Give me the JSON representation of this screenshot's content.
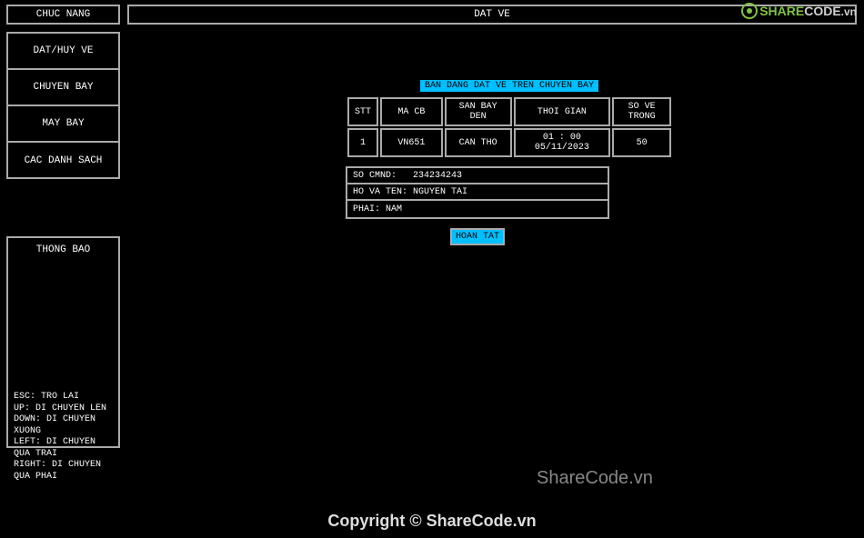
{
  "header": {
    "left": "CHUC NANG",
    "right": "DAT VE"
  },
  "menu": {
    "items": [
      "DAT/HUY VE",
      "CHUYEN BAY",
      "MAY BAY",
      "CAC DANH SACH"
    ]
  },
  "thong_bao": {
    "title": "THONG BAO",
    "help": {
      "esc": "ESC: TRO LAI",
      "up": "UP: DI CHUYEN LEN",
      "down": "DOWN: DI CHUYEN XUONG",
      "left": "LEFT: DI CHUYEN QUA TRAI",
      "right": "RIGHT: DI CHUYEN QUA PHAI"
    }
  },
  "content": {
    "title": "BAN DANG DAT VE TREN CHUYEN BAY",
    "table": {
      "headers": {
        "stt": "STT",
        "macb": "MA CB",
        "sanbay": "SAN BAY DEN",
        "thoigian": "THOI GIAN",
        "sove": "SO VE TRONG"
      },
      "row": {
        "stt": "1",
        "macb": "VN651",
        "sanbay": "CAN THO",
        "thoigian": "01 : 00  05/11/2023",
        "sove": "50"
      }
    },
    "info": {
      "cmnd_label": "SO CMND:",
      "cmnd_value": "234234243",
      "hoten_label": "HO VA TEN:",
      "hoten_value": "NGUYEN TAI",
      "phai_label": "PHAI:",
      "phai_value": "NAM"
    },
    "button": "HOAN TAT"
  },
  "watermark": {
    "share": "SHARE",
    "code": "CODE",
    "vn": ".vn",
    "text": "ShareCode.vn",
    "copyright": "Copyright © ShareCode.vn"
  }
}
